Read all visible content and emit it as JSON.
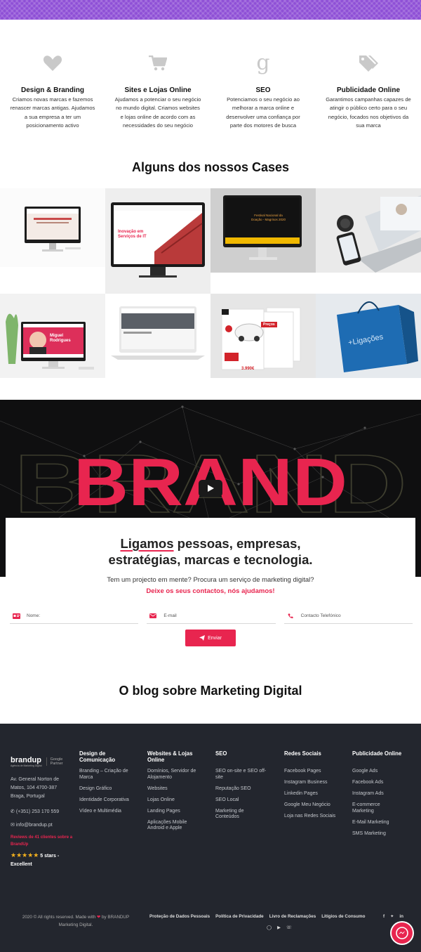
{
  "services": [
    {
      "icon": "heart-icon",
      "title": "Design & Branding",
      "desc": [
        "Criamos novas marcas e fazemos",
        "renascer marcas antigas. Ajudamos",
        "a sua empresa a ter um",
        "posicionamento activo"
      ]
    },
    {
      "icon": "cart-icon",
      "title": "Sites e Lojas Online",
      "desc": [
        "Ajudamos a potenciar o seu negócio",
        "no mundo digital. Criamos websites",
        "e lojas online de acordo com as",
        "necessidades do seu negócio"
      ]
    },
    {
      "icon": "google-icon",
      "title": "SEO",
      "desc": [
        "Potenciamos o seu negócio ao",
        "melhorar a marca online e",
        "desenvolver uma confiança por",
        "parte dos motores de busca"
      ]
    },
    {
      "icon": "tags-icon",
      "title": "Publicidade Online",
      "desc": [
        "Garantimos campanhas capazes de",
        "atingir o público certo para o seu",
        "negócio, focados nos objetivos da",
        "sua marca"
      ]
    }
  ],
  "cases_title": "Alguns dos nossos Cases",
  "cases_text": {
    "case2_line1": "Inovação em",
    "case2_line2": "Serviços de IT",
    "case3_line1": "Festival Nacional da",
    "case3_line2": "Doação - Magrisos 2020",
    "case5_line1": "Miguel",
    "case5_line2": "Rodrigues",
    "case7_price1": "3.990€",
    "case7_label": "Preços",
    "case8_brand": "+Ligações"
  },
  "brand_word": "BRAND",
  "tagline": {
    "highlight": "Ligamos",
    "line1_rest": " pessoas, empresas,",
    "line2": "estratégias, marcas e tecnologia."
  },
  "ask": "Tem um projecto em mente? Procura um serviço de marketing digital?",
  "ask_cta": "Deixe os seus contactos, nós ajudamos!",
  "form": {
    "name_placeholder": "Nome:",
    "email_placeholder": "E-mail",
    "phone_placeholder": "Contacto Telefónico",
    "send_label": "Enviar"
  },
  "blog_title": "O blog sobre Marketing Digital",
  "footer": {
    "logo": "brandup",
    "logo_sub": "Agência de Marketing Digital",
    "partner": [
      "Google",
      "Partner"
    ],
    "address": [
      "Av. General Norton de",
      "Matos, 104 4700-387",
      "Braga, Portugal"
    ],
    "phone": "(+351) 253 170 559",
    "email": "info@brandup.pt",
    "reviews": [
      "Reviews de 41 clientes sobre a",
      "BrandUp"
    ],
    "stars": "★★★★★",
    "rating": "5 stars -",
    "rating2": "Excellent",
    "columns": [
      {
        "title": [
          "Design de",
          "Comunicação"
        ],
        "links": [
          [
            "Branding – Criação de",
            "Marca"
          ],
          [
            "Design Gráfico"
          ],
          [
            "Identidade Corporativa"
          ],
          [
            "Vídeo e Multimédia"
          ]
        ]
      },
      {
        "title": [
          "Websites & Lojas",
          "Online"
        ],
        "links": [
          [
            "Domínios, Servidor de",
            "Alojamento"
          ],
          [
            "Websites"
          ],
          [
            "Lojas Online"
          ],
          [
            "Landing Pages"
          ],
          [
            "Aplicações Mobile",
            "Android e Apple"
          ]
        ]
      },
      {
        "title": [
          "SEO"
        ],
        "links": [
          [
            "SEO on-site e SEO off-",
            "site"
          ],
          [
            "Reputação SEO"
          ],
          [
            "SEO Local"
          ],
          [
            "Marketing de",
            "Conteúdos"
          ]
        ]
      },
      {
        "title": [
          "Redes Sociais"
        ],
        "links": [
          [
            "Facebook Pages"
          ],
          [
            "Instagram Business"
          ],
          [
            "Linkedin Pages"
          ],
          [
            "Google Meu Negócio"
          ],
          [
            "Loja nas Redes Sociais"
          ]
        ]
      },
      {
        "title": [
          "Publicidade Online"
        ],
        "links": [
          [
            "Google Ads"
          ],
          [
            "Facebook Ads"
          ],
          [
            "Instagram Ads"
          ],
          [
            "E-commerce",
            "Marketing"
          ],
          [
            "E-Mail Marketing"
          ],
          [
            "SMS Marketing"
          ]
        ]
      }
    ],
    "copyright": [
      "2020 © All rights reserved. Made with",
      "by BRANDUP",
      "Marketing Digital."
    ],
    "legal": [
      "Proteção de Dados Pessoais",
      "Política de Privacidade",
      "Livro de Reclamações",
      "Litígios de Consumo"
    ]
  },
  "colors": {
    "accent": "#e8254f",
    "purple": "#8e4fd6",
    "footer_bg": "#23262e"
  }
}
